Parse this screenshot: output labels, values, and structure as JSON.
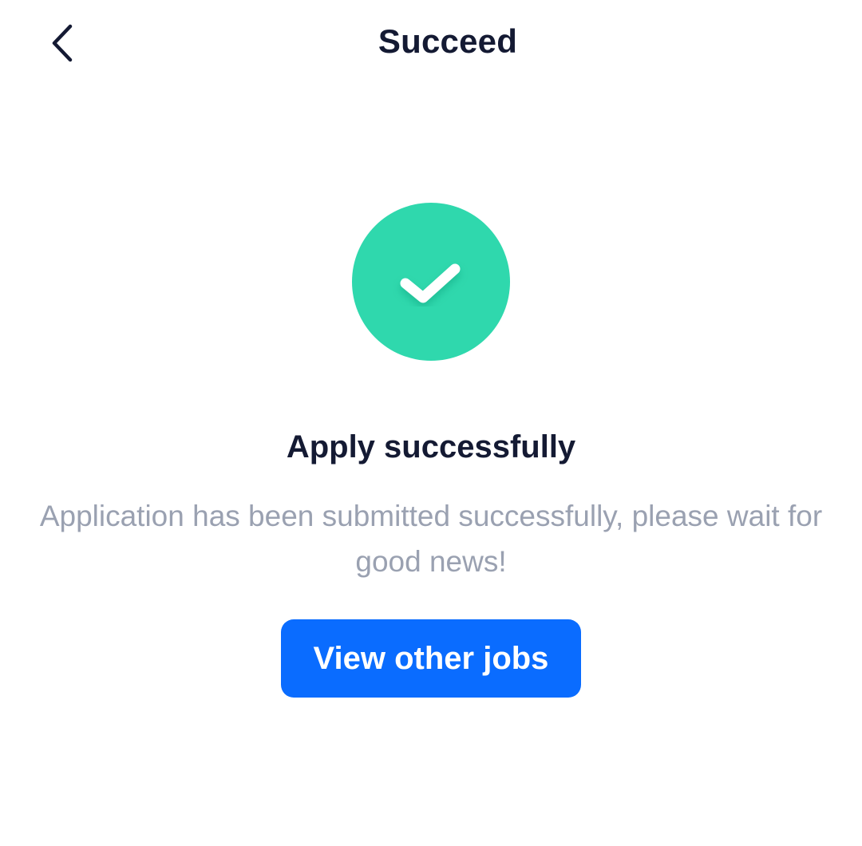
{
  "header": {
    "title": "Succeed",
    "back_icon": "chevron-left-icon"
  },
  "result": {
    "icon": "check-icon",
    "icon_color": "#2fd8ad",
    "title": "Apply successfully",
    "message": "Application has been submitted successfully, please wait for good news!"
  },
  "actions": {
    "view_jobs_label": "View other jobs",
    "button_color": "#0a6cff"
  }
}
